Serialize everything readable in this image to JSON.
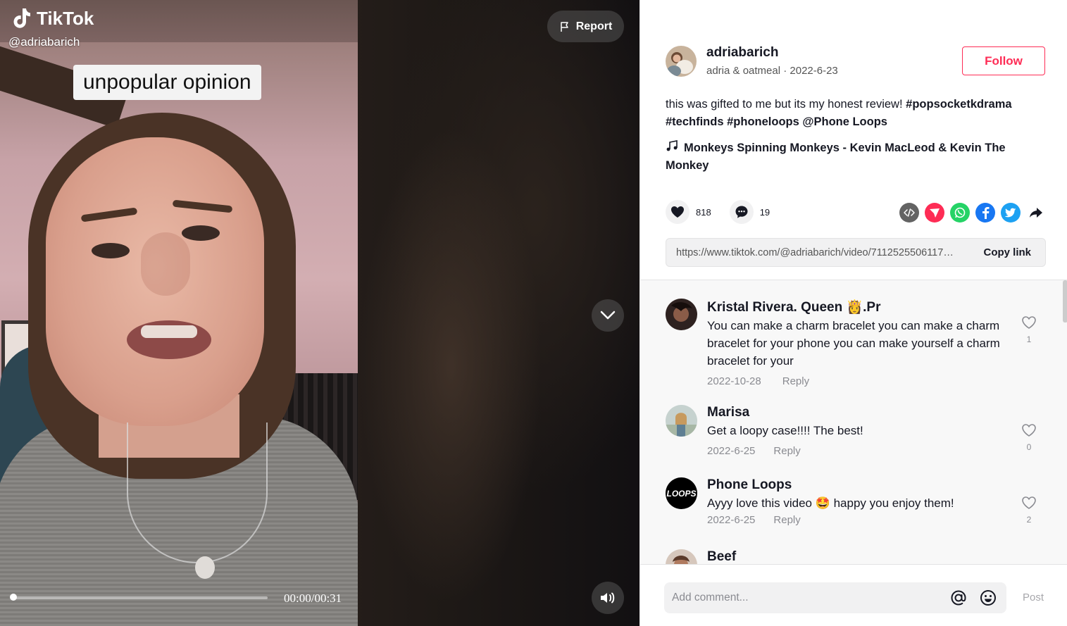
{
  "video": {
    "brand": "TikTok",
    "handle": "@adriabarich",
    "overlay_caption": "unpopular opinion",
    "time": "00:00/00:31",
    "progress_fraction": 0.0,
    "report_label": "Report"
  },
  "author": {
    "username": "adriabarich",
    "subtitle": "adria & oatmeal · 2022-6-23",
    "follow_label": "Follow"
  },
  "post": {
    "description_text": "this was gifted to me but its my honest review! ",
    "hashtags": [
      "#popsocketkdrama",
      "#techfinds",
      "#phoneloops",
      "@Phone Loops"
    ],
    "music": "Monkeys Spinning Monkeys - Kevin MacLeod & Kevin The Monkey"
  },
  "stats": {
    "likes": "818",
    "comments": "19"
  },
  "share": {
    "icons": [
      "embed-icon",
      "send-icon",
      "whatsapp-icon",
      "facebook-icon",
      "twitter-icon",
      "share-arrow-icon"
    ],
    "link_url": "https://www.tiktok.com/@adriabarich/video/7112525506117…",
    "copy_label": "Copy link"
  },
  "comments": [
    {
      "name": "Kristal Rivera. Queen 👸.Pr",
      "text": "You can make a charm bracelet you can make a charm bracelet for your phone you can make yourself a charm bracelet for your",
      "date": "2022-10-28",
      "reply": "Reply",
      "likes": "1"
    },
    {
      "name": "Marisa",
      "text": "Get a loopy case!!!! The best!",
      "date": "2022-6-25",
      "reply": "Reply",
      "likes": "0"
    },
    {
      "name": "Phone Loops",
      "text": "Ayyy love this video 🤩 happy you enjoy them!",
      "date": "2022-6-25",
      "reply": "Reply",
      "likes": "2"
    },
    {
      "name": "Beef",
      "text": "",
      "date": "",
      "reply": "",
      "likes": ""
    }
  ],
  "comment_input": {
    "placeholder": "Add comment...",
    "post_label": "Post"
  },
  "colors": {
    "accent": "#fe2c55",
    "text": "#161823",
    "muted": "#8a8b91"
  }
}
